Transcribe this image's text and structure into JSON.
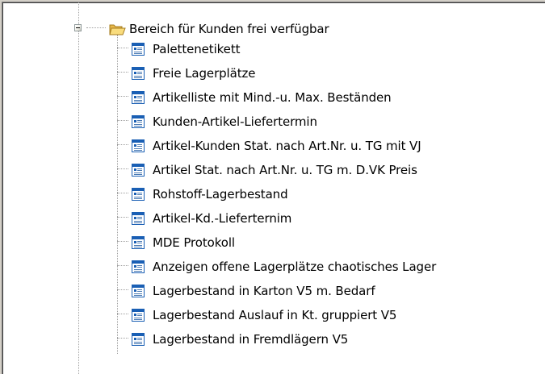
{
  "tree": {
    "folder": {
      "label": "Bereich für Kunden frei verfügbar",
      "icon": "open-folder-icon",
      "expanded": true
    },
    "items": [
      {
        "label": "Palettenetikett",
        "icon": "report-icon"
      },
      {
        "label": "Freie Lagerplätze",
        "icon": "report-icon"
      },
      {
        "label": "Artikelliste mit Mind.-u. Max. Beständen",
        "icon": "report-icon"
      },
      {
        "label": "Kunden-Artikel-Liefertermin",
        "icon": "report-icon"
      },
      {
        "label": "Artikel-Kunden Stat. nach Art.Nr. u. TG mit VJ",
        "icon": "report-icon"
      },
      {
        "label": "Artikel Stat. nach Art.Nr. u. TG m. D.VK Preis",
        "icon": "report-icon"
      },
      {
        "label": "Rohstoff-Lagerbestand",
        "icon": "report-icon"
      },
      {
        "label": "Artikel-Kd.-Lieferternim",
        "icon": "report-icon"
      },
      {
        "label": "MDE Protokoll",
        "icon": "report-icon"
      },
      {
        "label": "Anzeigen offene Lagerplätze chaotisches Lager",
        "icon": "report-icon"
      },
      {
        "label": "Lagerbestand in Karton V5 m. Bedarf",
        "icon": "report-icon"
      },
      {
        "label": "Lagerbestand Auslauf in Kt. gruppiert V5",
        "icon": "report-icon"
      },
      {
        "label": "Lagerbestand in Fremdlägern V5",
        "icon": "report-icon"
      }
    ]
  },
  "colors": {
    "window_bg": "#d4d0c8",
    "tree_bg": "#ffffff",
    "folder_yellow": "#f8d775",
    "report_blue": "#1a5fb4"
  }
}
